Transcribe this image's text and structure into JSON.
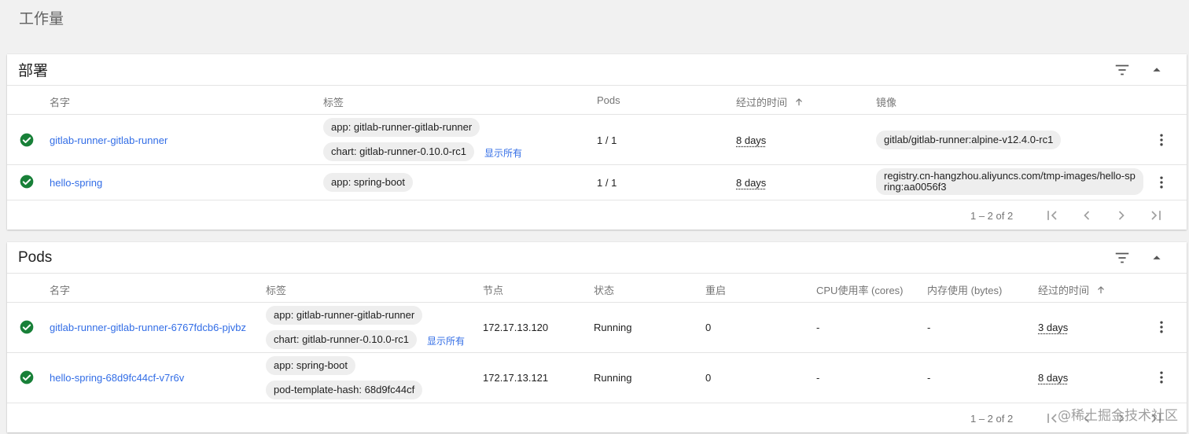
{
  "page_title": "工作量",
  "colors": {
    "link": "#326de6",
    "ok": "#188038",
    "chip": "#eeeeee"
  },
  "deployments": {
    "title": "部署",
    "columns": {
      "name": "名字",
      "labels": "标签",
      "pods": "Pods",
      "age": "经过的时间",
      "images": "镜像"
    },
    "rows": [
      {
        "status_icon": "check-circle-icon",
        "name": "gitlab-runner-gitlab-runner",
        "labels": [
          "app: gitlab-runner-gitlab-runner",
          "chart: gitlab-runner-0.10.0-rc1"
        ],
        "show_all": "显示所有",
        "pods": "1 / 1",
        "age": "8 days",
        "image": "gitlab/gitlab-runner:alpine-v12.4.0-rc1"
      },
      {
        "status_icon": "check-circle-icon",
        "name": "hello-spring",
        "labels": [
          "app: spring-boot"
        ],
        "pods": "1 / 1",
        "age": "8 days",
        "image": "registry.cn-hangzhou.aliyuncs.com/tmp-images/hello-spring:aa0056f3"
      }
    ],
    "pagination": "1 – 2 of 2"
  },
  "pods": {
    "title": "Pods",
    "columns": {
      "name": "名字",
      "labels": "标签",
      "node": "节点",
      "status": "状态",
      "restarts": "重启",
      "cpu": "CPU使用率 (cores)",
      "memory": "内存使用 (bytes)",
      "age": "经过的时间"
    },
    "rows": [
      {
        "status_icon": "check-circle-icon",
        "name": "gitlab-runner-gitlab-runner-6767fdcb6-pjvbz",
        "labels": [
          "app: gitlab-runner-gitlab-runner",
          "chart: gitlab-runner-0.10.0-rc1"
        ],
        "show_all": "显示所有",
        "node": "172.17.13.120",
        "status": "Running",
        "restarts": "0",
        "cpu": "-",
        "memory": "-",
        "age": "3 days"
      },
      {
        "status_icon": "check-circle-icon",
        "name": "hello-spring-68d9fc44cf-v7r6v",
        "labels": [
          "app: spring-boot",
          "pod-template-hash: 68d9fc44cf"
        ],
        "node": "172.17.13.121",
        "status": "Running",
        "restarts": "0",
        "cpu": "-",
        "memory": "-",
        "age": "8 days"
      }
    ],
    "pagination": "1 – 2 of 2"
  },
  "watermark": "@稀土掘金技术社区"
}
